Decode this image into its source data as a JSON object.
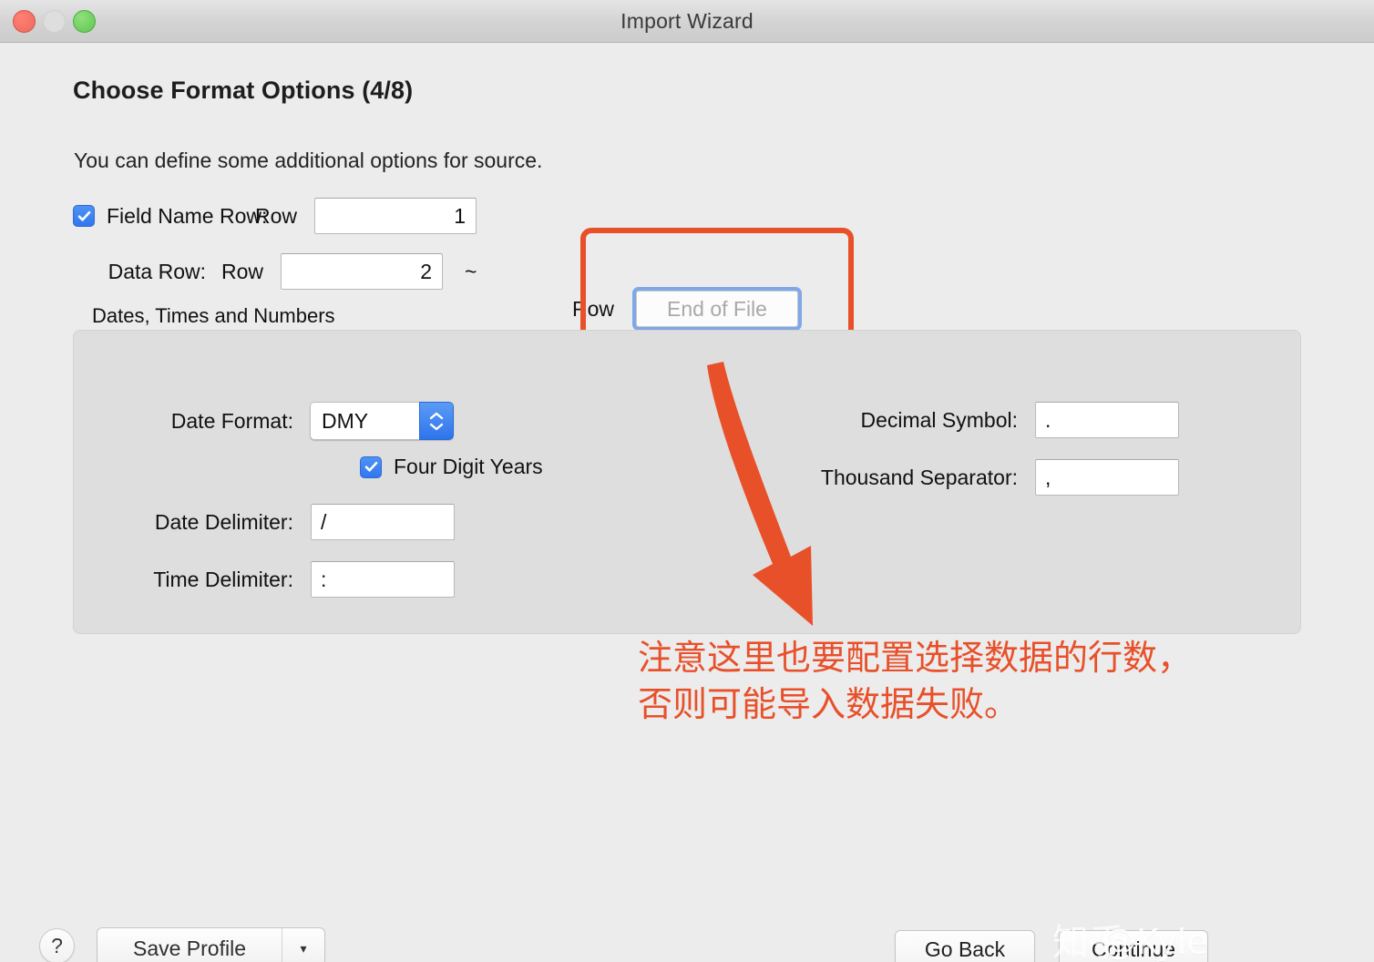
{
  "window": {
    "title": "Import Wizard",
    "traffic_lights": [
      "close",
      "minimize",
      "zoom"
    ]
  },
  "page": {
    "title": "Choose Format Options (4/8)",
    "subtitle": "You can define some additional options for source."
  },
  "rows": {
    "field_name_row": {
      "checkbox_checked": true,
      "label": "Field Name Row:",
      "row_word": "Row",
      "value": "1"
    },
    "data_row": {
      "label": "Data Row:",
      "row_word": "Row",
      "value": "2",
      "separator": "~",
      "row_word_2": "Row",
      "end_value": "",
      "end_placeholder": "End of File",
      "focused": true
    }
  },
  "group": {
    "caption": "Dates, Times and Numbers",
    "date_format": {
      "label": "Date Format:",
      "value": "DMY"
    },
    "four_digit_years": {
      "label": "Four Digit Years",
      "checked": true
    },
    "date_delimiter": {
      "label": "Date Delimiter:",
      "value": "/"
    },
    "time_delimiter": {
      "label": "Time Delimiter:",
      "value": ":"
    },
    "decimal_symbol": {
      "label": "Decimal Symbol:",
      "value": "."
    },
    "thousand_separator": {
      "label": "Thousand Separator:",
      "value": ","
    }
  },
  "annotation": {
    "text": "注意这里也要配置选择数据的行数，\n否则可能导入数据失败。",
    "color": "#e8502a"
  },
  "highlight": {
    "color": "#e8502a"
  },
  "footer": {
    "help_label": "?",
    "save_profile_label": "Save Profile",
    "save_profile_arrow": "▾",
    "go_back_label": "Go Back",
    "continue_label": "Continue"
  },
  "watermark": {
    "logo": "知乎",
    "handle": "@Kyle"
  },
  "colors": {
    "accent_orange": "#e8502a",
    "control_blue": "#3077ee",
    "focus_ring_blue": "#7fa8e8",
    "window_bg": "#ececec",
    "groupbox_bg": "#dedede"
  }
}
